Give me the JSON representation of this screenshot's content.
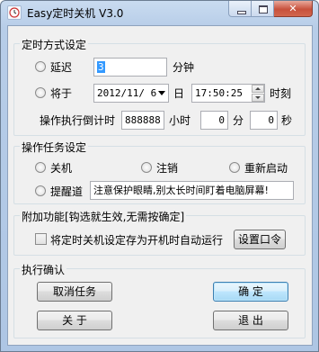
{
  "window": {
    "title": "Easy定时关机 V3.0"
  },
  "timing": {
    "group_title": "定时方式设定",
    "delay_label": "延迟",
    "delay_value": "3",
    "delay_unit": "分钟",
    "at_label": "将于",
    "date_value": "2012/11/ 6",
    "day_label": "日",
    "time_value": "17:50:25",
    "time_label": "时刻",
    "countdown_label": "操作执行倒计时",
    "countdown_value": "888888",
    "hours_label": "小时",
    "minutes_value": "0",
    "minutes_label": "分",
    "seconds_value": "0",
    "seconds_label": "秒"
  },
  "task": {
    "group_title": "操作任务设定",
    "shutdown_label": "关机",
    "logoff_label": "注销",
    "restart_label": "重新启动",
    "remind_label": "提醒道",
    "remind_value": "注意保护眼睛,别太长时间盯着电脑屏幕!"
  },
  "extra": {
    "group_title": "附加功能[钩选就生效,无需按确定]",
    "autorun_label": "将定时关机设定存为开机时自动运行",
    "password_button": "设置口令"
  },
  "confirm": {
    "group_title": "执行确认",
    "cancel_task_button": "取消任务",
    "ok_button": "确 定",
    "about_button": "关 于",
    "exit_button": "退 出"
  }
}
